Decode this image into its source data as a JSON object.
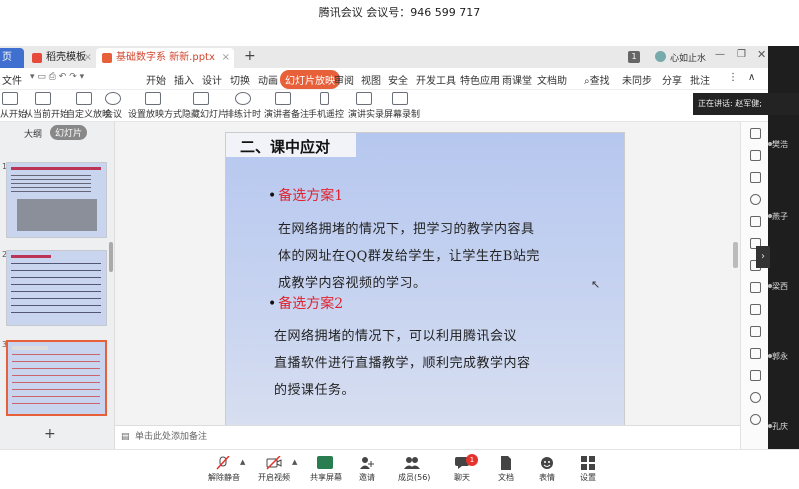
{
  "meeting": {
    "title": "腾讯会议 会议号：946 599 717",
    "speaker_text": "正在讲话: 赵军健;"
  },
  "wps": {
    "tabs": [
      {
        "label": "页"
      },
      {
        "label": "稻壳模板"
      },
      {
        "label": "基础数字系 新新.pptx"
      }
    ],
    "page_badge": "1",
    "user_label": "心如止水",
    "menu": [
      "文件",
      "开始",
      "插入",
      "设计",
      "切换",
      "动画",
      "幻灯片放映",
      "审阅",
      "视图",
      "安全",
      "开发工具",
      "特色应用",
      "雨课堂",
      "文档助"
    ],
    "menu_right": [
      "查找",
      "未同步",
      "分享",
      "批注"
    ],
    "ribbon": [
      "从开始",
      "从当前开始",
      "自定义放映",
      "会议",
      "设置放映方式",
      "隐藏幻灯片",
      "排练计时",
      "演讲者备注",
      "手机遥控",
      "演讲实录",
      "屏幕录制"
    ],
    "panel_tabs": [
      "大纲",
      "幻灯片"
    ],
    "thumb_numbers": [
      "1",
      "2",
      "3"
    ],
    "notes_placeholder": "单击此处添加备注"
  },
  "slide": {
    "title": "二、课中应对",
    "plan1_head": "备选方案1",
    "plan1_lines": [
      "在网络拥堵的情况下，把学习的教学内容具",
      "体的网址在QQ群发给学生，让学生在B站完",
      "成教学内容视频的学习。"
    ],
    "plan2_head": "备选方案2",
    "plan2_lines": [
      "在网络拥堵的情况下，可以利用腾讯会议",
      "直播软件进行直播教学，顺利完成教学内容",
      "的授课任务。"
    ]
  },
  "videos": [
    "樊浩",
    "燕子",
    "梁西",
    "郭永",
    "孔庆"
  ],
  "bottom": {
    "buttons": [
      "解除静音",
      "开启视频",
      "共享屏幕",
      "邀请",
      "成员(56)",
      "聊天",
      "文档",
      "表情",
      "设置"
    ],
    "chat_badge": "1"
  },
  "colors": {
    "accent": "#e0232e",
    "ribbon_active": "#e8603a"
  }
}
